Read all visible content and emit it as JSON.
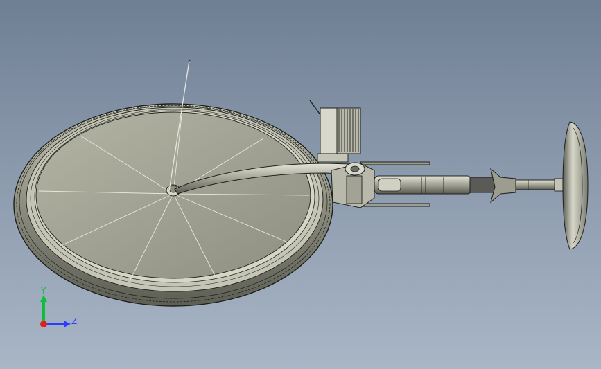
{
  "viewport": {
    "background_top": "#6f7f93",
    "background_bottom": "#a9b6c6",
    "model_color": "#a7a898",
    "edge_color": "#1d1f1b"
  },
  "triad": {
    "y_label": "Y",
    "z_label": "Z",
    "y_color": "#0fbf3a",
    "z_color": "#2a3cff",
    "x_color": "#e0201d"
  },
  "model": {
    "parts": [
      "front-wheel",
      "tire-tread",
      "spokes",
      "hub",
      "fork",
      "antenna",
      "handlebar-mount",
      "frame-tube",
      "bracket",
      "seat-post",
      "seat"
    ]
  }
}
